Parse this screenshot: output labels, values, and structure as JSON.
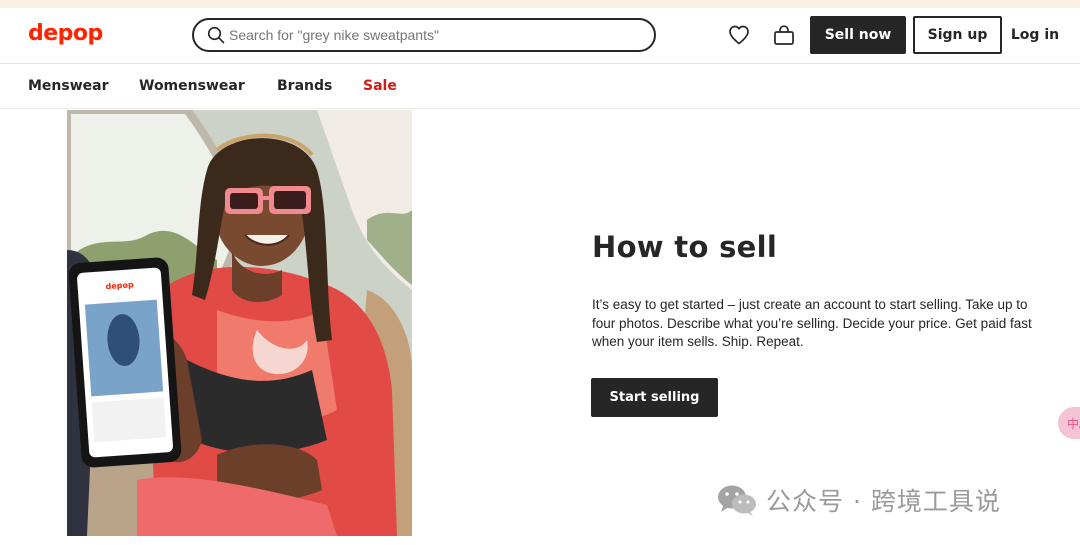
{
  "header": {
    "logo": "depop",
    "search_placeholder": "Search for \"grey nike sweatpants\"",
    "sell_now": "Sell now",
    "sign_up": "Sign up",
    "log_in": "Log in",
    "icons": [
      "heart-icon",
      "bag-icon",
      "search-icon"
    ]
  },
  "nav": {
    "items": [
      {
        "label": "Menswear"
      },
      {
        "label": "Womenswear"
      },
      {
        "label": "Brands"
      },
      {
        "label": "Sale"
      }
    ]
  },
  "hero": {
    "title": "How to sell",
    "description": "It’s easy to get started – just create an account to start selling. Take up to four photos. Describe what you’re selling. Decide your price. Get paid fast when your item sells. Ship. Repeat.",
    "cta": "Start selling",
    "phone_logo": "depop"
  },
  "floating_tab": {
    "label": "中A"
  },
  "watermark": {
    "text": "公众号 · 跨境工具说"
  },
  "colors": {
    "brand": "#ff2300",
    "sale": "#d11b1b",
    "dark": "#262626",
    "top_strip": "#fbeee3"
  }
}
